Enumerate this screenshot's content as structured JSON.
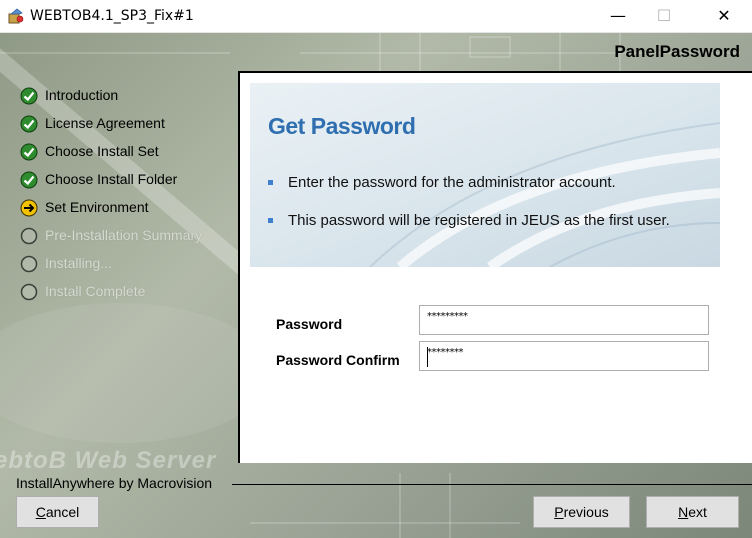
{
  "window": {
    "title": "WEBTOB4.1_SP3_Fix#1",
    "controls": {
      "minimize": "—",
      "maximize": "☐",
      "close": "✕"
    }
  },
  "installer": {
    "panel_title": "PanelPassword",
    "steps": [
      {
        "label": "Introduction",
        "state": "done"
      },
      {
        "label": "License Agreement",
        "state": "done"
      },
      {
        "label": "Choose Install Set",
        "state": "done"
      },
      {
        "label": "Choose Install Folder",
        "state": "done"
      },
      {
        "label": "Set Environment",
        "state": "current"
      },
      {
        "label": "Pre-Installation Summary",
        "state": "pending"
      },
      {
        "label": "Installing...",
        "state": "pending"
      },
      {
        "label": "Install Complete",
        "state": "pending"
      }
    ],
    "brand_watermark": "ebtoB Web Server",
    "footer_brand": "InstallAnywhere by Macrovision"
  },
  "content": {
    "heading": "Get Password",
    "bullets": [
      "Enter the password for the administrator account.",
      "This password will be registered in JEUS as the first user."
    ],
    "password_label": "Password",
    "password_value": "*********",
    "confirm_label": "Password Confirm",
    "confirm_value": "********"
  },
  "buttons": {
    "cancel": {
      "mnemonic": "C",
      "rest": "ancel"
    },
    "previous": {
      "mnemonic": "P",
      "rest": "revious"
    },
    "next": {
      "mnemonic": "N",
      "rest": "ext"
    }
  },
  "colors": {
    "heading_blue": "#2f6fb0",
    "bullet_blue": "#3f7fcf",
    "check_green": "#2e8b2e",
    "current_yellow": "#f2c200"
  }
}
